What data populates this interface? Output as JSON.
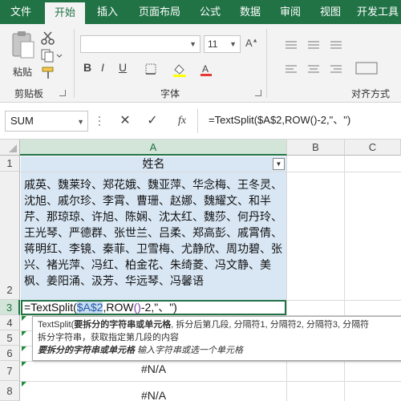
{
  "ribbon_tabs": [
    {
      "label": "文件"
    },
    {
      "label": "开始"
    },
    {
      "label": "插入"
    },
    {
      "label": "页面布局"
    },
    {
      "label": "公式"
    },
    {
      "label": "数据"
    },
    {
      "label": "审阅"
    },
    {
      "label": "视图"
    },
    {
      "label": "开发工具"
    }
  ],
  "active_tab": "开始",
  "clipboard": {
    "paste_label": "粘贴",
    "group_label": "剪贴板"
  },
  "font": {
    "size": "11",
    "group_label": "字体",
    "bold": "B",
    "italic": "I",
    "underline": "U"
  },
  "alignment": {
    "group_label": "对齐方式"
  },
  "formula_bar": {
    "name_box": "SUM",
    "cancel_icon": "✕",
    "enter_icon": "✓",
    "fx_label": "fx",
    "formula": "=TextSplit($A$2,ROW()-2,\"、\")"
  },
  "sheet": {
    "columns": [
      "A",
      "B",
      "C"
    ],
    "rows": [
      "1",
      "2",
      "3",
      "4",
      "5",
      "6",
      "7",
      "8"
    ],
    "a1": "姓名",
    "a2": "戚英、魏莱玲、郑花娥、魏亚萍、华念梅、王冬灵、沈旭、戚尔珍、李霄、曹珊、赵娜、魏耀文、和半芹、那琼琼、许旭、陈娴、沈太红、魏莎、何丹玲、王光琴、严德群、张世兰、吕柔、郑高彭、戚霄倩、蒋明红、李镜、秦菲、卫雪梅、尤静欣、周功碧、张兴、褚光萍、冯红、柏金花、朱绮菱、冯文静、美枫、姜阳涌、汲芳、华远琴、冯馨语",
    "a3": {
      "prefix": "=TextSplit(",
      "ref": "$A$2",
      "mid": ",ROW",
      "parens": "()",
      "suffix": "-2,\"、\")"
    },
    "na_rows": [
      "#N/A",
      "#N/A"
    ]
  },
  "tooltip": {
    "line1_start": "TextSplit(",
    "line1_bold": "要拆分的字符串或单元格",
    "line1_rest": ", 拆分后第几段, 分隔符1, 分隔符2, 分隔符3, 分隔符",
    "line2": "拆分字符串，获取指定第几段的内容",
    "line3_bold": "要拆分的字符串或单元格",
    "line3_rest": "  输入字符串或选一个单元格"
  },
  "colors": {
    "accent": "#217346",
    "selection": "#d9e7f5",
    "ref_text": "#2159a8",
    "error_marker": "#1e8c3a"
  }
}
